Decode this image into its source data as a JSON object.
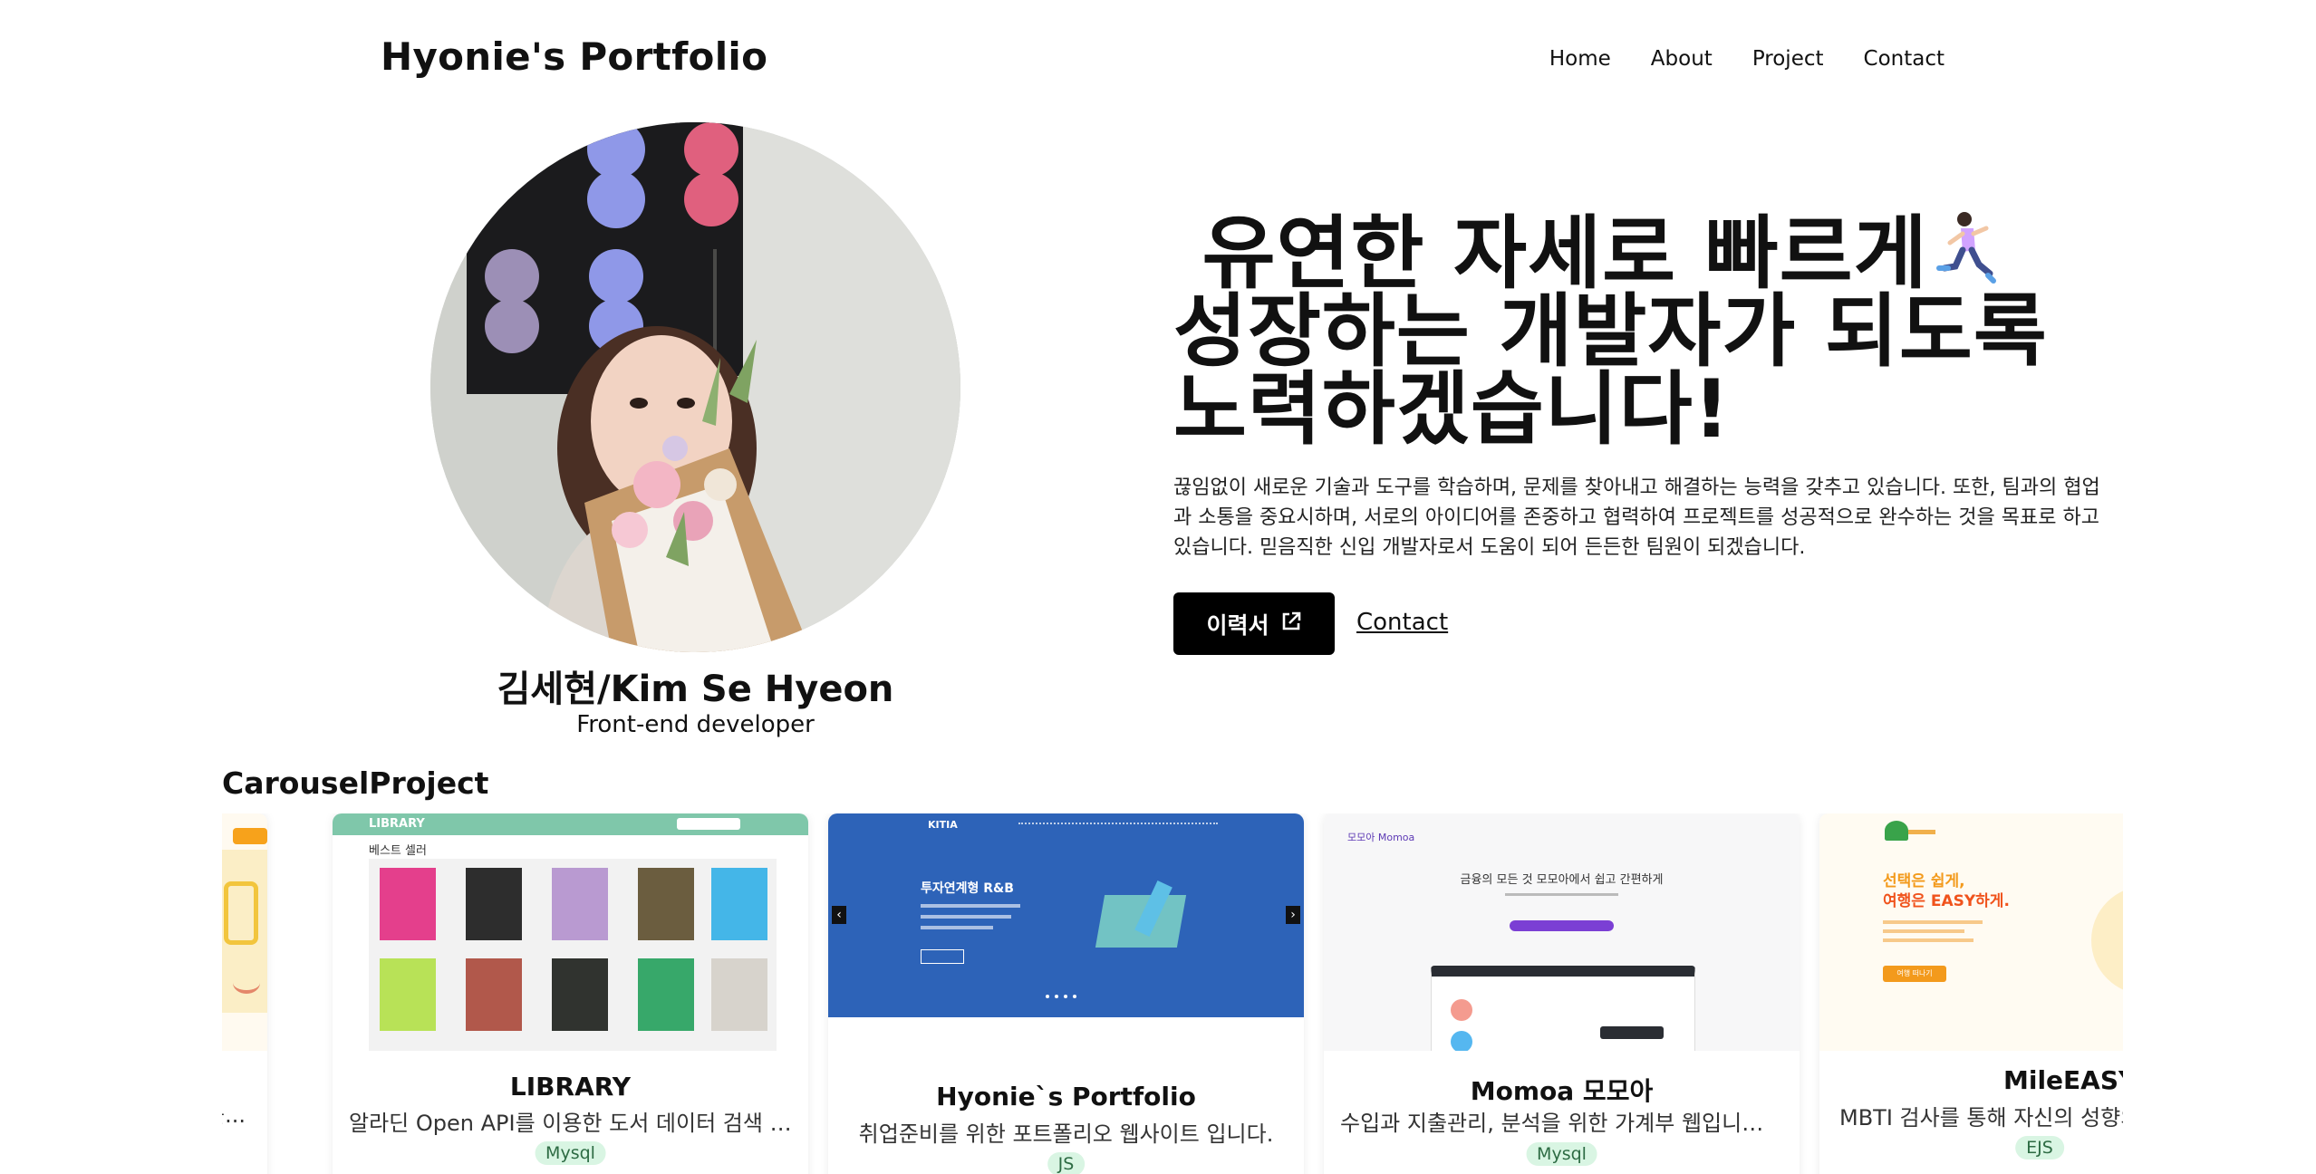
{
  "header": {
    "brand": "Hyonie's Portfolio",
    "nav": [
      "Home",
      "About",
      "Project",
      "Contact"
    ]
  },
  "profile": {
    "name": "김세현/Kim Se Hyeon",
    "role": "Front-end developer"
  },
  "hero": {
    "headline_line1": " 유연한 자세로 빠르게",
    "headline_line2": "성장하는 개발자가 되도록",
    "headline_line3": "노력하겠습니다!",
    "intro": "끊임없이 새로운 기술과 도구를 학습하며, 문제를 찾아내고 해결하는 능력을 갖추고 있습니다. 또한, 팀과의 협업과 소통을 중요시하며, 서로의 아이디어를 존중하고 협력하여 프로젝트를 성공적으로 완수하는 것을 목표로 하고 있습니다. 믿음직한 신입 개발자로서 도움이 되어 든든한 팀원이 되겠습니다.",
    "resume_label": "이력서",
    "contact_label": "Contact"
  },
  "carousel": {
    "title": "CarouselProject",
    "partial_left_desc": "뱅지를...",
    "cards": [
      {
        "title": "LIBRARY",
        "desc": "알라딘 Open API를 이용한 도서 데이터 검색 사이트입니다.",
        "tag": "Mysql",
        "thumb_logo": "LIBRARY",
        "thumb_section": "베스트 셀러"
      },
      {
        "title": "Hyonie`s Portfolio",
        "desc": "취업준비를 위한 포트폴리오 웹사이트 입니다.",
        "tag": "JS",
        "thumb_logo": "KITIA",
        "thumb_headline": "투자연계형 R&B"
      },
      {
        "title": "Momoa 모모아",
        "desc": "수입과 지출관리, 분석을 위한 가계부 웹입니다. 사용자 맞춤",
        "tag": "Mysql",
        "thumb_logo": "모모아 Momoa",
        "thumb_headline": "금융의 모든 것 모모아에서 쉽고 간편하게"
      },
      {
        "title": "MileEASY",
        "desc": "MBTI 검사를 통해 자신의 성향의",
        "tag": "EJS",
        "thumb_headline1": "선택은 쉽게,",
        "thumb_headline2": "여행은 EASY하게.",
        "thumb_button": "여행 떠나기"
      }
    ]
  },
  "colors": {
    "accent_button": "#000000",
    "tag_bg": "#d9f5e3",
    "library_header": "#7fc7aa",
    "kitia_blue": "#2d63b8",
    "momoa_purple": "#7b3fd4",
    "mileeasy_orange": "#f39a1c"
  }
}
